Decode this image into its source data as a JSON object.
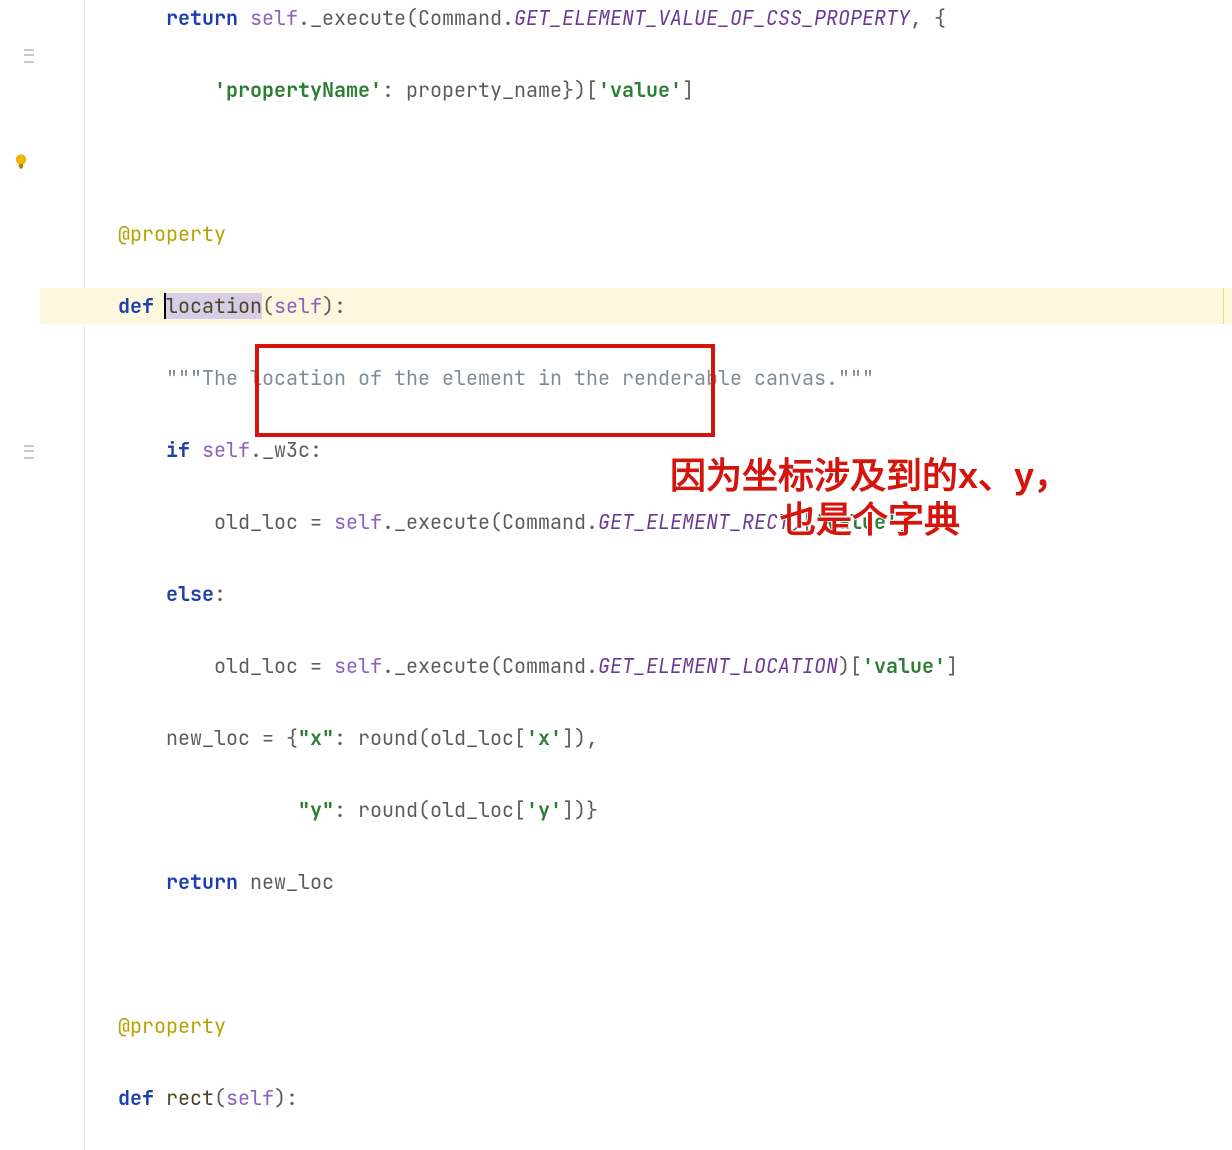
{
  "lines": {
    "l0a": "return ",
    "l0b": "self",
    "l0c": "._execute(Command.",
    "l0d": "GET_ELEMENT_VALUE_OF_CSS_PROPERTY",
    "l0e": ", {",
    "l1a": "'propertyName'",
    "l1b": ": property_name})[",
    "l1c": "'value'",
    "l1d": "]",
    "l3a": "@property",
    "l4a": "def ",
    "l4b": "location",
    "l4c": "(",
    "l4d": "self",
    "l4e": "):",
    "l5a": "\"\"\"The location of the element in the renderable canvas.\"\"\"",
    "l6a": "if ",
    "l6b": "self",
    "l6c": "._w3c:",
    "l7a": "old_loc = ",
    "l7b": "self",
    "l7c": "._execute(Command.",
    "l7d": "GET_ELEMENT_RECT",
    "l7e": ")[",
    "l7f": "'value'",
    "l7g": "]",
    "l8a": "else",
    "l8b": ":",
    "l9a": "old_loc = ",
    "l9b": "self",
    "l9c": "._execute(Command.",
    "l9d": "GET_ELEMENT_LOCATION",
    "l9e": ")[",
    "l9f": "'value'",
    "l9g": "]",
    "l10a": "new_loc = {",
    "l10b": "\"x\"",
    "l10c": ": round(old_loc[",
    "l10d": "'x'",
    "l10e": "]),",
    "l11a": "\"y\"",
    "l11b": ": round(old_loc[",
    "l11c": "'y'",
    "l11d": "])}",
    "l12a": "return ",
    "l12b": "new_loc",
    "l14a": "@property",
    "l15a": "def ",
    "l15b": "rect",
    "l15c": "(",
    "l15d": "self",
    "l15e": "):"
  },
  "annotation": {
    "line1": "因为坐标涉及到的x、y，",
    "line2": "也是个字典"
  }
}
